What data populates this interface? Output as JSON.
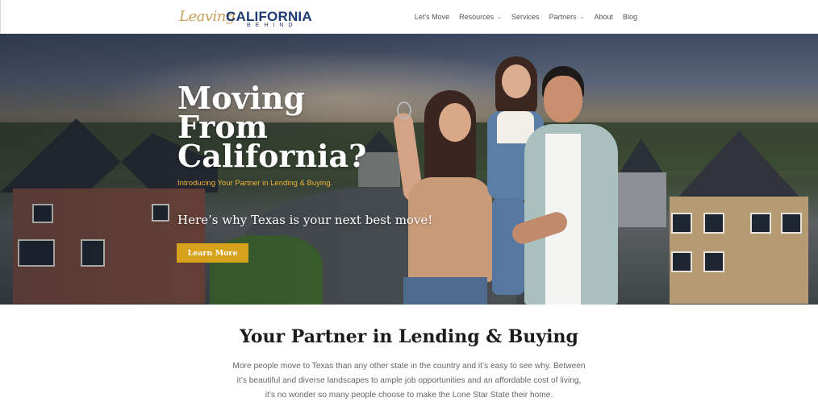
{
  "header": {
    "logo": {
      "script_text": "Leaving",
      "brand_text": "CALIFORNIA",
      "sub_text": "BEHIND"
    },
    "nav": [
      {
        "label": "Let's Move",
        "has_dropdown": false
      },
      {
        "label": "Resources",
        "has_dropdown": true
      },
      {
        "label": "Services",
        "has_dropdown": false
      },
      {
        "label": "Partners",
        "has_dropdown": true
      },
      {
        "label": "About",
        "has_dropdown": false
      },
      {
        "label": "Blog",
        "has_dropdown": false
      }
    ],
    "dropdown_glyph": "⌄"
  },
  "hero": {
    "title_line1": "Moving",
    "title_line2": "From",
    "title_line3": "California?",
    "subtitle": "Introducing Your Partner in Lending & Buying.",
    "tagline": "Here’s why Texas is your next best move!",
    "cta_label": "Learn More",
    "accent_color": "#d7a21b"
  },
  "section": {
    "title": "Your Partner in Lending & Buying",
    "body_line1": "More people move to Texas than any other state in the country and it’s easy to see why. Between",
    "body_line2": "it’s beautiful and diverse landscapes to ample job opportunities and an affordable cost of living,",
    "body_line3": "it’s no wonder so many people choose to make the Lone Star State their home."
  }
}
